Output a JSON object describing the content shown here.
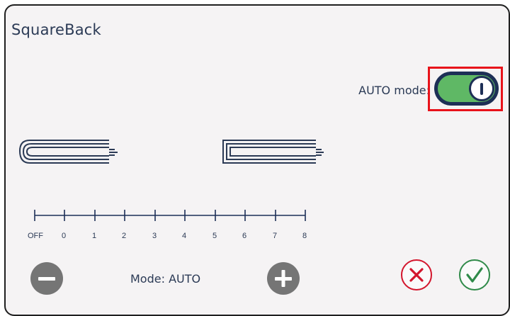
{
  "title": "SquareBack",
  "auto_mode": {
    "label": "AUTO mode:",
    "enabled": true
  },
  "scale": {
    "labels": [
      "OFF",
      "0",
      "1",
      "2",
      "3",
      "4",
      "5",
      "6",
      "7",
      "8"
    ]
  },
  "mode": {
    "text": "Mode: AUTO"
  },
  "icons": {
    "decrease": "minus-icon",
    "increase": "plus-icon",
    "cancel": "x-icon",
    "confirm": "check-icon"
  },
  "colors": {
    "toggle_on": "#5fb865",
    "toggle_border": "#1d2f56",
    "highlight": "#e8121a",
    "cancel": "#d3152c",
    "confirm": "#2f8a49",
    "stepper": "#757575",
    "text": "#2b3a55"
  }
}
